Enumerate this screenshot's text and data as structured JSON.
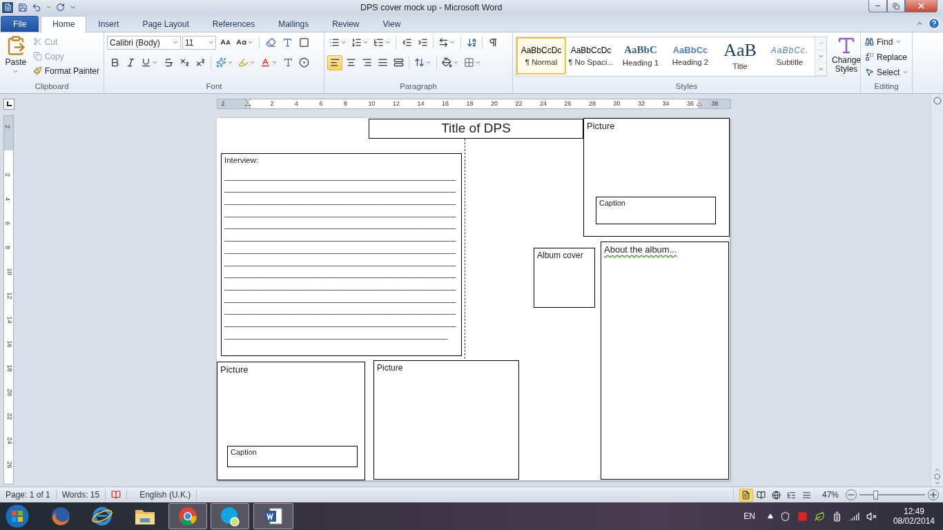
{
  "window": {
    "title": "DPS cover mock up  -  Microsoft Word"
  },
  "tabs": [
    {
      "label": "File",
      "kind": "file",
      "selected": false
    },
    {
      "label": "Home",
      "kind": "tab",
      "selected": true
    },
    {
      "label": "Insert",
      "kind": "tab",
      "selected": false
    },
    {
      "label": "Page Layout",
      "kind": "tab",
      "selected": false
    },
    {
      "label": "References",
      "kind": "tab",
      "selected": false
    },
    {
      "label": "Mailings",
      "kind": "tab",
      "selected": false
    },
    {
      "label": "Review",
      "kind": "tab",
      "selected": false
    },
    {
      "label": "View",
      "kind": "tab",
      "selected": false
    }
  ],
  "clipboard": {
    "label": "Clipboard",
    "paste": "Paste",
    "actions": [
      {
        "label": "Cut",
        "disabled": true
      },
      {
        "label": "Copy",
        "disabled": true
      },
      {
        "label": "Format Painter",
        "disabled": false
      }
    ]
  },
  "font": {
    "label": "Font",
    "family": "Calibri (Body)",
    "size": "11"
  },
  "paragraph": {
    "label": "Paragraph",
    "alignments": [
      {
        "selected": true
      },
      {
        "selected": false
      },
      {
        "selected": false
      },
      {
        "selected": false
      },
      {
        "selected": false
      }
    ]
  },
  "styles": {
    "label": "Styles",
    "change_styles": "Change Styles",
    "items": [
      {
        "preview": "AaBbCcDc",
        "name": "¶ Normal",
        "kind": "normal",
        "selected": true
      },
      {
        "preview": "AaBbCcDc",
        "name": "¶ No Spaci...",
        "kind": "normal",
        "selected": false
      },
      {
        "preview": "AaBbC",
        "name": "Heading 1",
        "kind": "heading1",
        "selected": false
      },
      {
        "preview": "AaBbCc",
        "name": "Heading 2",
        "kind": "heading2",
        "selected": false
      },
      {
        "preview": "AaB",
        "name": "Title",
        "kind": "title",
        "selected": false
      },
      {
        "preview": "AaBbCc.",
        "name": "Subtitle",
        "kind": "subtitle",
        "selected": false
      }
    ]
  },
  "editing": {
    "label": "Editing",
    "items": [
      "Find",
      "Replace",
      "Select"
    ]
  },
  "ruler": {
    "horizontal": [
      "2",
      "2",
      "4",
      "6",
      "8",
      "10",
      "12",
      "14",
      "16",
      "18",
      "20",
      "22",
      "24",
      "26",
      "28",
      "30",
      "32",
      "34",
      "36",
      "38"
    ],
    "vertical": [
      "2",
      "2",
      "4",
      "6",
      "8",
      "10",
      "12",
      "14",
      "16",
      "18",
      "20",
      "22",
      "24",
      "26"
    ]
  },
  "document": {
    "title": "Title of DPS",
    "interview": {
      "heading": "Interview:",
      "lines": [
        "__________________________________________________________",
        "__________________________________________________________",
        "__________________________________________________________",
        "__________________________________________________________",
        "__________________________________________________________",
        "__________________________________________________________",
        "__________________________________________________________",
        "__________________________________________________________",
        "__________________________________________________________",
        "__________________________________________________________",
        "__________________________________________________________",
        "__________________________________________________________",
        "__________________________________________________________",
        "________________________________________________________"
      ]
    },
    "boxes": [
      {
        "kind": "picture",
        "label": "Picture",
        "caption": "Caption"
      },
      {
        "kind": "album",
        "label": "Album cover"
      },
      {
        "kind": "about",
        "label": "About the album..."
      },
      {
        "kind": "picture",
        "label": "Picture",
        "caption": "Caption"
      },
      {
        "kind": "picture",
        "label": "Picture"
      }
    ]
  },
  "status_bar": {
    "page": "Page: 1 of 1",
    "words": "Words: 15",
    "language": "English (U.K.)",
    "views": [
      {
        "selected": true
      },
      {
        "selected": false
      },
      {
        "selected": false
      },
      {
        "selected": false
      },
      {
        "selected": false
      }
    ],
    "zoom": "47%",
    "zoom_slider": {
      "level": 0.24
    }
  },
  "taskbar": {
    "apps": [
      {
        "kind": "start",
        "open": false
      },
      {
        "kind": "fox",
        "open": false
      },
      {
        "kind": "ie",
        "open": false
      },
      {
        "kind": "folder",
        "open": false
      },
      {
        "kind": "chrome",
        "open": true
      },
      {
        "kind": "chat",
        "open": true
      },
      {
        "kind": "word",
        "open": true
      }
    ],
    "language": "EN",
    "time": "12:49",
    "date": "08/02/2014"
  }
}
